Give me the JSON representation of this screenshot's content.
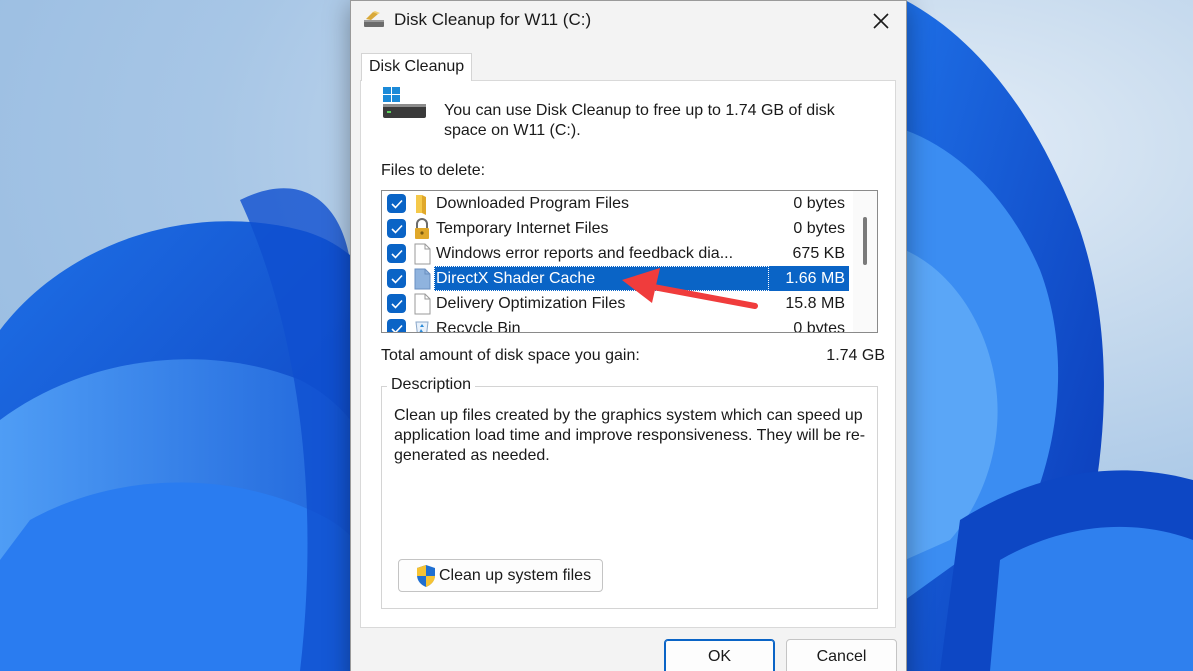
{
  "window": {
    "title": "Disk Cleanup for W11 (C:)"
  },
  "tab": {
    "label": "Disk Cleanup"
  },
  "intro": {
    "text": "You can use Disk Cleanup to free up to 1.74 GB of disk space on W11 (C:)."
  },
  "files_section": {
    "label": "Files to delete:",
    "items": [
      {
        "name": "Downloaded Program Files",
        "size": "0 bytes",
        "checked": true,
        "icon": "folder-icon"
      },
      {
        "name": "Temporary Internet Files",
        "size": "0 bytes",
        "checked": true,
        "icon": "lock-icon"
      },
      {
        "name": "Windows error reports and feedback dia...",
        "size": "675 KB",
        "checked": true,
        "icon": "file-icon"
      },
      {
        "name": "DirectX Shader Cache",
        "size": "1.66 MB",
        "checked": true,
        "icon": "file-icon",
        "selected": true
      },
      {
        "name": "Delivery Optimization Files",
        "size": "15.8 MB",
        "checked": true,
        "icon": "file-icon"
      },
      {
        "name": "Recycle Bin",
        "size": "0 bytes",
        "checked": true,
        "icon": "recycle-bin-icon"
      }
    ]
  },
  "total": {
    "label": "Total amount of disk space you gain:",
    "value": "1.74 GB"
  },
  "description": {
    "legend": "Description",
    "text": "Clean up files created by the graphics system which can speed up application load time and improve responsiveness. They will be re-generated as needed."
  },
  "buttons": {
    "cleanup_system": "Clean up system files",
    "ok": "OK",
    "cancel": "Cancel"
  },
  "colors": {
    "accent": "#0a64c6",
    "annotation_arrow": "#f03c3c"
  }
}
